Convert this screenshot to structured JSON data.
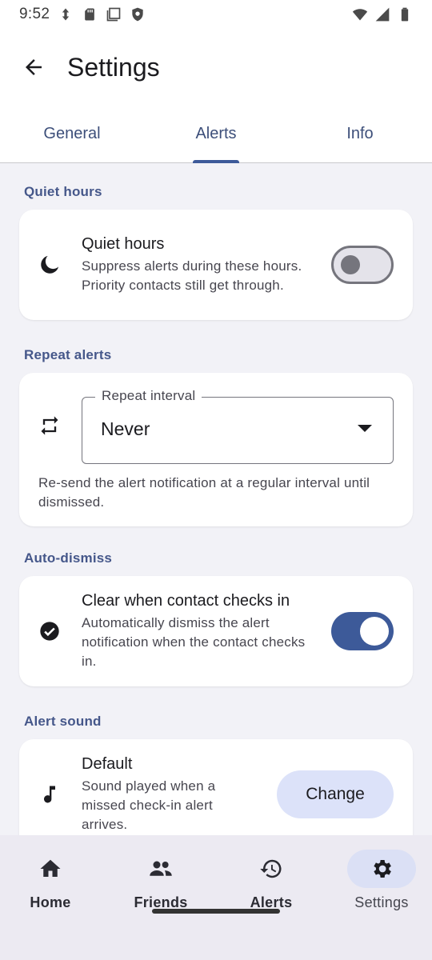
{
  "status_bar": {
    "time": "9:52",
    "icons_left": [
      "data-saver-icon",
      "sd-card-icon",
      "screenshot-icon",
      "shield-icon"
    ],
    "icons_right": [
      "wifi-icon",
      "cell-signal-icon",
      "battery-icon"
    ]
  },
  "header": {
    "title": "Settings",
    "back_icon": "arrow-back-icon"
  },
  "tabs": [
    {
      "label": "General",
      "selected": false
    },
    {
      "label": "Alerts",
      "selected": true
    },
    {
      "label": "Info",
      "selected": false
    }
  ],
  "sections": {
    "quiet_hours": {
      "header": "Quiet hours",
      "title": "Quiet hours",
      "description": "Suppress alerts during these hours. Priority contacts still get through.",
      "icon": "moon-icon",
      "enabled": false
    },
    "repeat_alerts": {
      "header": "Repeat alerts",
      "icon": "repeat-icon",
      "field_label": "Repeat interval",
      "field_value": "Never",
      "description": "Re-send the alert notification at a regular interval until dismissed."
    },
    "auto_dismiss": {
      "header": "Auto-dismiss",
      "title": "Clear when contact checks in",
      "description": "Automatically dismiss the alert notification when the contact checks in.",
      "icon": "check-circle-icon",
      "enabled": true
    },
    "alert_sound": {
      "header": "Alert sound",
      "title": "Default",
      "description": "Sound played when a missed check-in alert arrives.",
      "icon": "music-note-icon",
      "button_label": "Change"
    }
  },
  "bottom_nav": [
    {
      "label": "Home",
      "icon": "home-icon",
      "active": false
    },
    {
      "label": "Friends",
      "icon": "people-icon",
      "active": false
    },
    {
      "label": "Alerts",
      "icon": "history-icon",
      "active": false
    },
    {
      "label": "Settings",
      "icon": "gear-icon",
      "active": true
    }
  ],
  "colors": {
    "accent": "#3d5a99",
    "section_header": "#45578a",
    "tonal_button": "#dce2f9",
    "background": "#f2f2f7",
    "nav_background": "#eceaf2"
  }
}
